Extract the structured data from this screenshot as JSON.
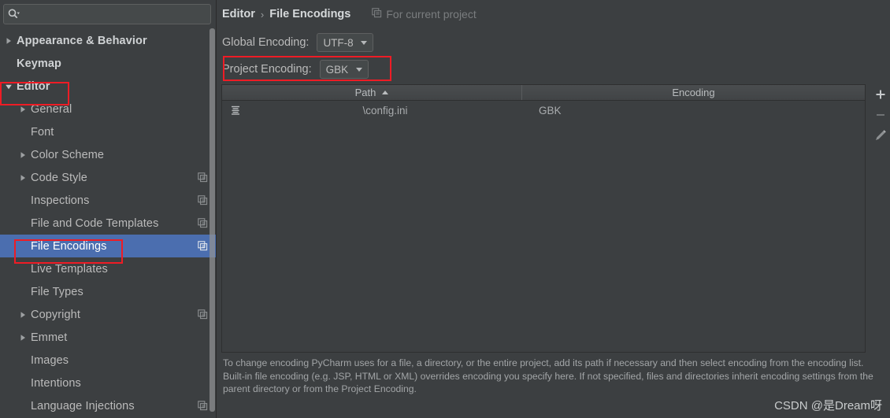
{
  "search": {
    "value": "",
    "placeholder": "",
    "icon": "search-icon"
  },
  "sidebar": {
    "items": [
      {
        "label": "Appearance & Behavior",
        "level": 0,
        "twisty": "right",
        "selected": false,
        "badge": ""
      },
      {
        "label": "Keymap",
        "level": 0,
        "twisty": "",
        "selected": false,
        "badge": ""
      },
      {
        "label": "Editor",
        "level": 0,
        "twisty": "down",
        "selected": false,
        "badge": ""
      },
      {
        "label": "General",
        "level": 1,
        "twisty": "right",
        "selected": false,
        "badge": ""
      },
      {
        "label": "Font",
        "level": 1,
        "twisty": "",
        "selected": false,
        "badge": ""
      },
      {
        "label": "Color Scheme",
        "level": 1,
        "twisty": "right",
        "selected": false,
        "badge": ""
      },
      {
        "label": "Code Style",
        "level": 1,
        "twisty": "right",
        "selected": false,
        "badge": "copy-icon"
      },
      {
        "label": "Inspections",
        "level": 1,
        "twisty": "",
        "selected": false,
        "badge": "copy-icon"
      },
      {
        "label": "File and Code Templates",
        "level": 1,
        "twisty": "",
        "selected": false,
        "badge": "copy-icon"
      },
      {
        "label": "File Encodings",
        "level": 1,
        "twisty": "",
        "selected": true,
        "badge": "copy-icon"
      },
      {
        "label": "Live Templates",
        "level": 1,
        "twisty": "",
        "selected": false,
        "badge": ""
      },
      {
        "label": "File Types",
        "level": 1,
        "twisty": "",
        "selected": false,
        "badge": ""
      },
      {
        "label": "Copyright",
        "level": 1,
        "twisty": "right",
        "selected": false,
        "badge": "copy-icon"
      },
      {
        "label": "Emmet",
        "level": 1,
        "twisty": "right",
        "selected": false,
        "badge": ""
      },
      {
        "label": "Images",
        "level": 1,
        "twisty": "",
        "selected": false,
        "badge": ""
      },
      {
        "label": "Intentions",
        "level": 1,
        "twisty": "",
        "selected": false,
        "badge": ""
      },
      {
        "label": "Language Injections",
        "level": 1,
        "twisty": "",
        "selected": false,
        "badge": "copy-icon"
      }
    ]
  },
  "main": {
    "breadcrumb": {
      "root": "Editor",
      "separator": "›",
      "current": "File Encodings"
    },
    "scope_note": {
      "label": "For current project",
      "icon": "copy-icon"
    },
    "global_encoding": {
      "label": "Global Encoding:",
      "value": "UTF-8"
    },
    "project_encoding": {
      "label": "Project Encoding:",
      "value": "GBK"
    },
    "table": {
      "columns": [
        "Path",
        "Encoding"
      ],
      "sort_column": "Path",
      "sort_direction": "ascending",
      "rows": [
        {
          "icon": "file-list-icon",
          "path": "\\config.ini",
          "encoding": "GBK"
        }
      ]
    },
    "tools": [
      {
        "name": "add-button",
        "glyph": "+"
      },
      {
        "name": "remove-button",
        "glyph": "−"
      },
      {
        "name": "edit-button",
        "glyph": "pencil-icon"
      }
    ],
    "hint": "To change encoding PyCharm uses for a file, a directory, or the entire project, add its path if necessary and then select encoding from the encoding list. Built-in file encoding (e.g. JSP, HTML or XML) overrides encoding you specify here. If not specified, files and directories inherit encoding settings from the parent directory or from the Project Encoding.",
    "watermark": "CSDN @是Dream呀"
  },
  "annotations": {
    "color": "#ee1c25",
    "boxes": [
      "editor-tree-item",
      "file-encodings-tree-item",
      "project-encoding-field"
    ]
  }
}
